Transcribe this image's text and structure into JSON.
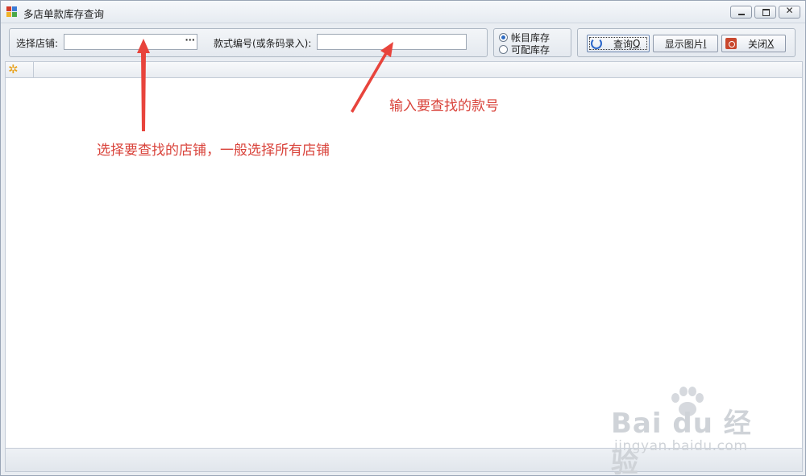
{
  "window": {
    "title": "多店单款库存查询",
    "controls": {
      "close_glyph": "✕"
    }
  },
  "toolbar": {
    "store_label": "选择店铺:",
    "store_value": "",
    "store_button_label": "···",
    "style_label": "款式编号(或条码录入):",
    "style_value": "",
    "stock_options": [
      {
        "label": "帐目库存",
        "selected": true
      },
      {
        "label": "可配库存",
        "selected": false
      }
    ],
    "query_label": "查询",
    "query_hotkey": "Q",
    "show_pic_label": "显示图片",
    "show_pic_hotkey": "I",
    "close_label": "关闭",
    "close_hotkey": "X"
  },
  "grid": {
    "corner_icon": "gear-icon",
    "corner_glyph": "✲",
    "columns": [],
    "rows": []
  },
  "annotations": {
    "store_hint": "选择要查找的店铺，一般选择所有店铺",
    "style_hint": "输入要查找的款号",
    "color": "#d9433b"
  },
  "watermark": {
    "logo_text": "Bai du 经验",
    "url": "jingyan.baidu.com"
  }
}
